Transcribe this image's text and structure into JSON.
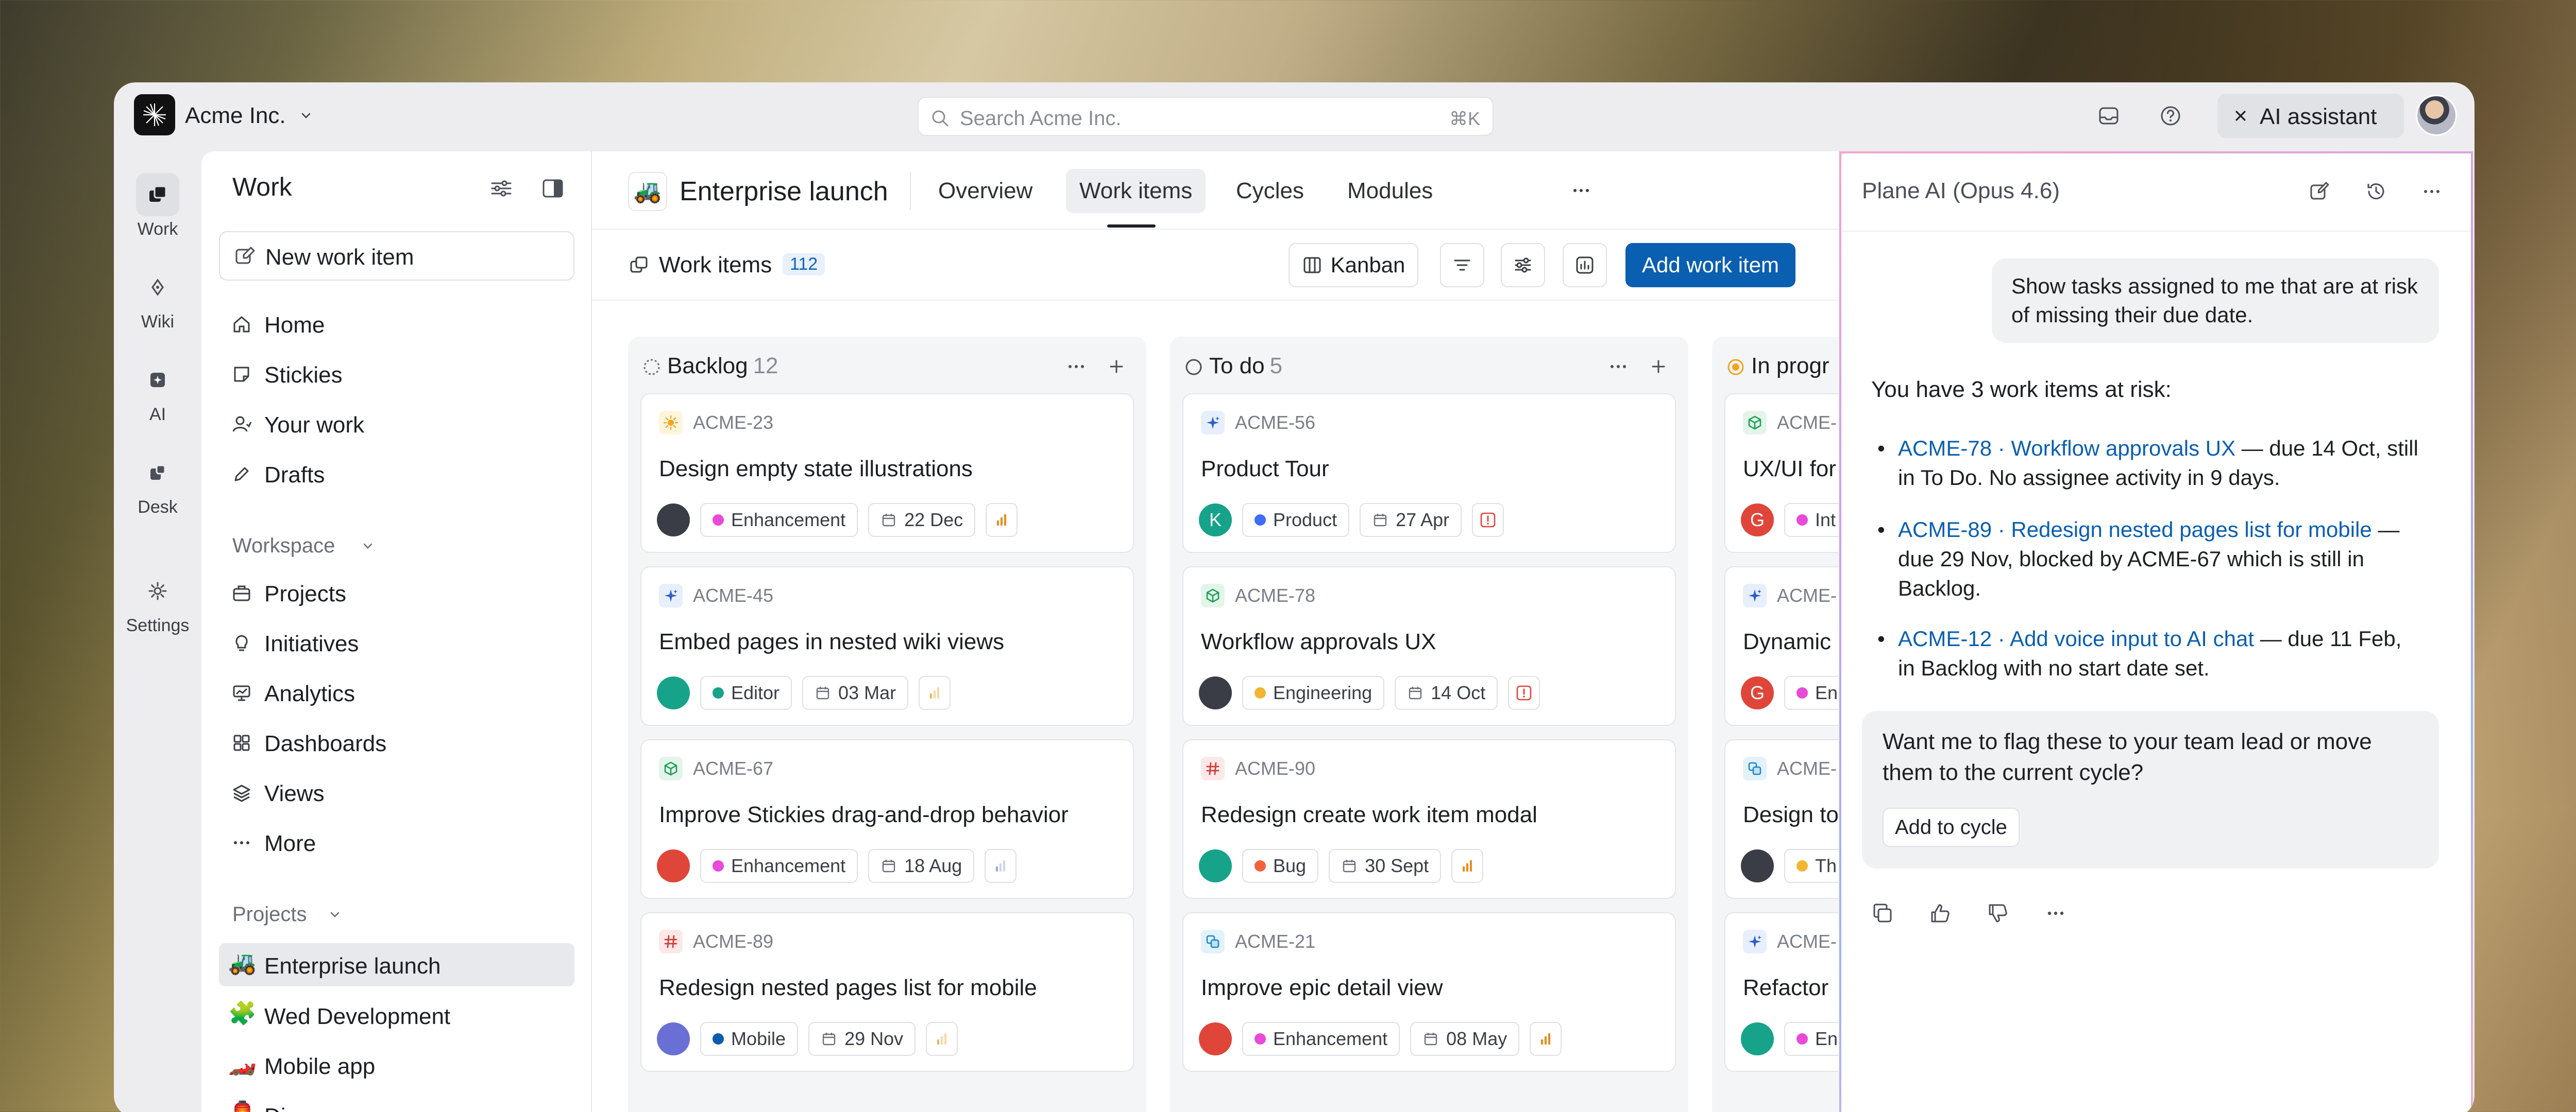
{
  "topbar": {
    "org_name": "Acme Inc.",
    "search_placeholder": "Search Acme Inc.",
    "search_shortcut": "⌘K",
    "ai_assistant_label": "AI assistant"
  },
  "rail": [
    {
      "label": "Work",
      "icon": "work-icon"
    },
    {
      "label": "Wiki",
      "icon": "wiki-icon"
    },
    {
      "label": "AI",
      "icon": "ai-icon"
    },
    {
      "label": "Desk",
      "icon": "desk-icon"
    },
    {
      "label": "Settings",
      "icon": "gear-icon"
    }
  ],
  "sidebar": {
    "title": "Work",
    "new_item": "New work item",
    "nav": [
      "Home",
      "Stickies",
      "Your work",
      "Drafts"
    ],
    "workspace_label": "Workspace",
    "workspace": [
      "Projects",
      "Initiatives",
      "Analytics",
      "Dashboards",
      "Views",
      "More"
    ],
    "projects_label": "Projects",
    "projects": [
      {
        "emoji": "🚜",
        "name": "Enterprise launch"
      },
      {
        "emoji": "🧩",
        "name": "Wed Development"
      },
      {
        "emoji": "🏎️",
        "name": "Mobile app"
      },
      {
        "emoji": "🏮",
        "name": "Di..."
      }
    ]
  },
  "main": {
    "project_emoji": "🚜",
    "project_title": "Enterprise launch",
    "tabs": [
      "Overview",
      "Work items",
      "Cycles",
      "Modules"
    ],
    "active_tab": "Work items",
    "work_items_label": "Work items",
    "work_items_count": "112",
    "layout_label": "Kanban",
    "add_button": "Add work item"
  },
  "board": {
    "columns": [
      {
        "name": "Backlog",
        "count": "12",
        "cards": [
          {
            "id": "ACME-23",
            "type_icon": "sun-icon",
            "title": "Design empty state illustrations",
            "label": "Enhancement",
            "label_color": "#e84ad9",
            "date": "22 Dec",
            "priority": "medium"
          },
          {
            "id": "ACME-45",
            "type_icon": "sparkle-icon",
            "title": "Embed pages in nested wiki views",
            "label": "Editor",
            "label_color": "#16a389",
            "date": "03 Mar",
            "priority": "low"
          },
          {
            "id": "ACME-67",
            "type_icon": "cube-icon",
            "title": "Improve Stickies drag-and-drop behavior",
            "label": "Enhancement",
            "label_color": "#e84ad9",
            "date": "18 Aug",
            "priority": "none"
          },
          {
            "id": "ACME-89",
            "type_icon": "hash-icon",
            "title": "Redesign nested pages list for mobile",
            "label": "Mobile",
            "label_color": "#0b5cad",
            "date": "29 Nov",
            "priority": "low"
          }
        ]
      },
      {
        "name": "To do",
        "count": "5",
        "cards": [
          {
            "id": "ACME-56",
            "type_icon": "sparkle-icon",
            "title": "Product Tour",
            "label": "Product",
            "label_color": "#3b6ef5",
            "date": "27 Apr",
            "priority": "urgent",
            "avatar_letter": "K"
          },
          {
            "id": "ACME-78",
            "type_icon": "cube-icon",
            "title": "Workflow approvals UX",
            "label": "Engineering",
            "label_color": "#f2b531",
            "date": "14 Oct",
            "priority": "urgent"
          },
          {
            "id": "ACME-90",
            "type_icon": "hash-icon",
            "title": "Redesign create work item modal",
            "label": "Bug",
            "label_color": "#f2623a",
            "date": "30 Sept",
            "priority": "medium"
          },
          {
            "id": "ACME-21",
            "type_icon": "layers-icon",
            "title": "Improve epic detail view",
            "label": "Enhancement",
            "label_color": "#e84ad9",
            "date": "08 May",
            "priority": "medium"
          }
        ]
      },
      {
        "name": "In progr",
        "count": "",
        "cards": [
          {
            "id": "ACME-",
            "type_icon": "cube-icon",
            "title": "UX/UI for",
            "label": "Int",
            "label_color": "#e84ad9",
            "avatar_letter": "G"
          },
          {
            "id": "ACME-",
            "type_icon": "sparkle-icon",
            "title": "Dynamic",
            "label": "En",
            "label_color": "#e84ad9",
            "avatar_letter": "G"
          },
          {
            "id": "ACME-",
            "type_icon": "layers-icon",
            "title": "Design to",
            "label": "Th",
            "label_color": "#f2b531"
          },
          {
            "id": "ACME-",
            "type_icon": "sparkle-icon",
            "title": "Refactor",
            "label": "En",
            "label_color": "#e84ad9"
          }
        ]
      }
    ]
  },
  "ai_panel": {
    "title": "Plane AI (Opus 4.6)",
    "user_message": "Show tasks assigned to me that are at risk of missing their due date.",
    "intro": "You have 3 work items at risk:",
    "items": [
      {
        "link": "ACME-78 · Workflow approvals UX",
        "text": " — due 14 Oct, still in To Do. No assignee activity in 9 days."
      },
      {
        "link": "ACME-89 · Redesign nested pages list for mobile",
        "text": " — due 29 Nov, blocked by ACME-67 which is still in Backlog."
      },
      {
        "link": "ACME-12 · Add voice input to AI chat",
        "text": " — due 11 Feb, in Backlog with no start date set."
      }
    ],
    "followup": "Want me to flag these to your team lead or move them to the current cycle?",
    "followup_button": "Add to cycle"
  }
}
